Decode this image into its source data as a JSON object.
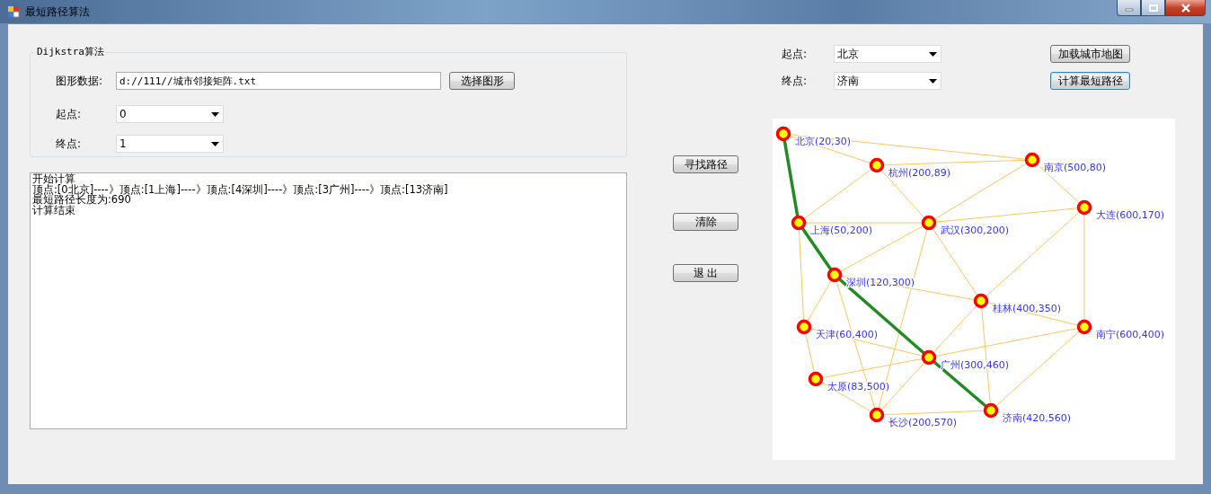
{
  "window": {
    "title": "最短路径算法"
  },
  "dijkstra": {
    "legend": "Dijkstra算法",
    "file_label": "图形数据:",
    "file_value": "d://111//城市邻接矩阵.txt",
    "choose_button": "选择图形",
    "start_label": "起点:",
    "start_value": "0",
    "end_label": "终点:",
    "end_value": "1"
  },
  "log": [
    "开始计算",
    "顶点:[0北京]----》顶点:[1上海]----》顶点:[4深圳]----》顶点:[3广州]----》顶点:[13济南]",
    "最短路径长度为:690",
    "计算结束"
  ],
  "middle_buttons": [
    "寻找路径",
    "清除",
    "退 出"
  ],
  "map_controls": {
    "start_label": "起点:",
    "start_value": "北京",
    "end_label": "终点:",
    "end_value": "济南",
    "load_button": "加载城市地图",
    "compute_button": "计算最短路径"
  },
  "map": {
    "nodes": [
      {
        "label": "北京(20,30)",
        "on_route": true
      },
      {
        "label": "杭州(200,89)",
        "on_route": false
      },
      {
        "label": "南京(500,80)",
        "on_route": false
      },
      {
        "label": "大连(600,170)",
        "on_route": false
      },
      {
        "label": "上海(50,200)",
        "on_route": true
      },
      {
        "label": "武汉(300,200)",
        "on_route": false
      },
      {
        "label": "深圳(120,300)",
        "on_route": true
      },
      {
        "label": "桂林(400,350)",
        "on_route": false
      },
      {
        "label": "天津(60,400)",
        "on_route": false
      },
      {
        "label": "南宁(600,400)",
        "on_route": false
      },
      {
        "label": "广州(300,460)",
        "on_route": true
      },
      {
        "label": "太原(83,500)",
        "on_route": false
      },
      {
        "label": "长沙(200,570)",
        "on_route": false
      },
      {
        "label": "济南(420,560)",
        "on_route": true
      }
    ]
  }
}
